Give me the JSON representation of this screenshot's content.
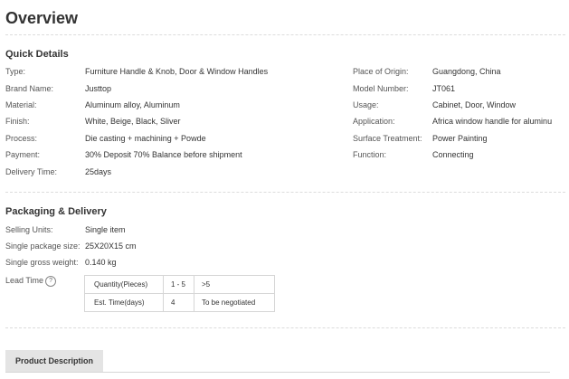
{
  "page_title": "Overview",
  "quick_details": {
    "title": "Quick Details",
    "left": [
      {
        "label": "Type:",
        "value": "Furniture Handle & Knob, Door & Window Handles"
      },
      {
        "label": "Brand Name:",
        "value": "Justtop"
      },
      {
        "label": "Material:",
        "value": "Aluminum alloy, Aluminum"
      },
      {
        "label": "Finish:",
        "value": "White, Beige, Black, Sliver"
      },
      {
        "label": "Process:",
        "value": "Die casting + machining + Powde"
      },
      {
        "label": "Payment:",
        "value": "30% Deposit 70% Balance before shipment"
      },
      {
        "label": "Delivery Time:",
        "value": "25days"
      }
    ],
    "right": [
      {
        "label": "Place of Origin:",
        "value": "Guangdong, China"
      },
      {
        "label": "Model Number:",
        "value": "JT061"
      },
      {
        "label": "Usage:",
        "value": "Cabinet, Door, Window"
      },
      {
        "label": "Application:",
        "value": "Africa window handle for aluminu"
      },
      {
        "label": "Surface Treatment:",
        "value": "Power Painting"
      },
      {
        "label": "Function:",
        "value": "Connecting"
      }
    ]
  },
  "packaging": {
    "title": "Packaging & Delivery",
    "rows": [
      {
        "label": "Selling Units:",
        "value": "Single item"
      },
      {
        "label": "Single package size:",
        "value": "25X20X15 cm"
      },
      {
        "label": "Single gross weight:",
        "value": "0.140 kg"
      }
    ],
    "lead_time_label": "Lead Time",
    "help_icon": "?",
    "lead_table": [
      [
        "Quantity(Pieces)",
        "1 - 5",
        ">5"
      ],
      [
        "Est. Time(days)",
        "4",
        "To be negotiated"
      ]
    ]
  },
  "product_description_label": "Product Description"
}
